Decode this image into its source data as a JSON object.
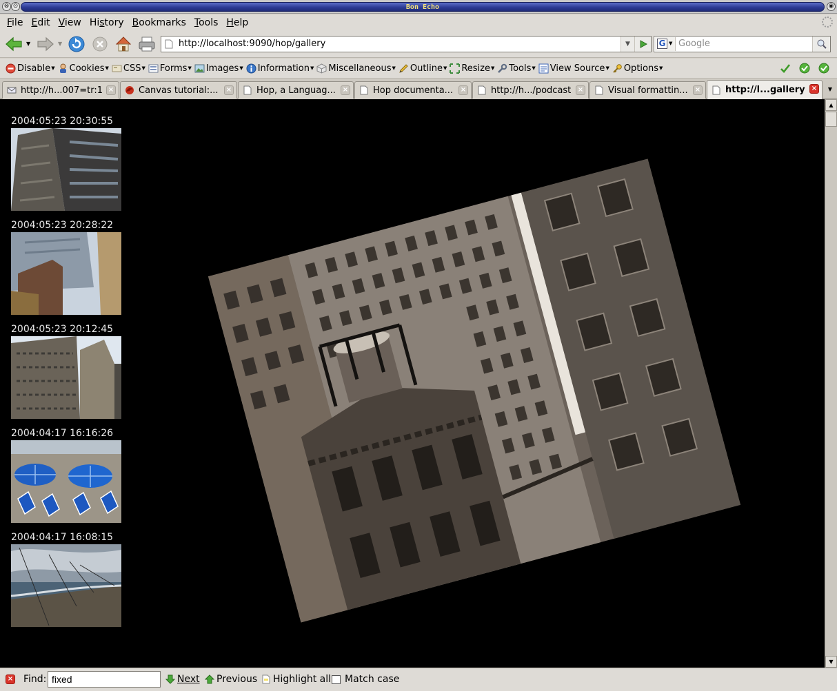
{
  "window": {
    "title": "Bon Echo"
  },
  "menu": [
    "File",
    "Edit",
    "View",
    "History",
    "Bookmarks",
    "Tools",
    "Help"
  ],
  "menu_mnemonic": [
    "F",
    "E",
    "V",
    "s",
    "B",
    "T",
    "H"
  ],
  "nav": {
    "url": "http://localhost:9090/hop/gallery",
    "search_placeholder": "Google"
  },
  "devtoolbar": [
    {
      "label": "Disable",
      "icon": "disable-icon"
    },
    {
      "label": "Cookies",
      "icon": "cookie-person-icon"
    },
    {
      "label": "CSS",
      "icon": "css-icon"
    },
    {
      "label": "Forms",
      "icon": "form-icon"
    },
    {
      "label": "Images",
      "icon": "image-icon"
    },
    {
      "label": "Information",
      "icon": "info-icon"
    },
    {
      "label": "Miscellaneous",
      "icon": "cube-icon"
    },
    {
      "label": "Outline",
      "icon": "pencil-icon"
    },
    {
      "label": "Resize",
      "icon": "resize-icon"
    },
    {
      "label": "Tools",
      "icon": "wrench-icon"
    },
    {
      "label": "View Source",
      "icon": "source-icon"
    },
    {
      "label": "Options",
      "icon": "key-icon"
    }
  ],
  "tabs": [
    {
      "label": "http://h...007=tr:1",
      "icon": "mail-icon",
      "active": false
    },
    {
      "label": "Canvas tutorial:...",
      "icon": "firefox-icon",
      "active": false
    },
    {
      "label": "Hop, a Languag...",
      "icon": "page-icon",
      "active": false
    },
    {
      "label": "Hop documenta...",
      "icon": "page-icon",
      "active": false
    },
    {
      "label": "http://h.../podcast",
      "icon": "page-icon",
      "active": false
    },
    {
      "label": "Visual formattin...",
      "icon": "page-icon",
      "active": false
    },
    {
      "label": "http://l...gallery",
      "icon": "page-icon",
      "active": true
    }
  ],
  "gallery": {
    "thumbnails": [
      {
        "timestamp": "2004:05:23 20:30:55"
      },
      {
        "timestamp": "2004:05:23 20:28:22"
      },
      {
        "timestamp": "2004:05:23 20:12:45"
      },
      {
        "timestamp": "2004:04:17 16:16:26"
      },
      {
        "timestamp": "2004:04:17 16:08:15"
      }
    ],
    "main_image_rotation_deg": -15
  },
  "findbar": {
    "label": "Find:",
    "value": "fixed",
    "next": "Next",
    "previous": "Previous",
    "highlight": "Highlight all",
    "matchcase": "Match case"
  }
}
